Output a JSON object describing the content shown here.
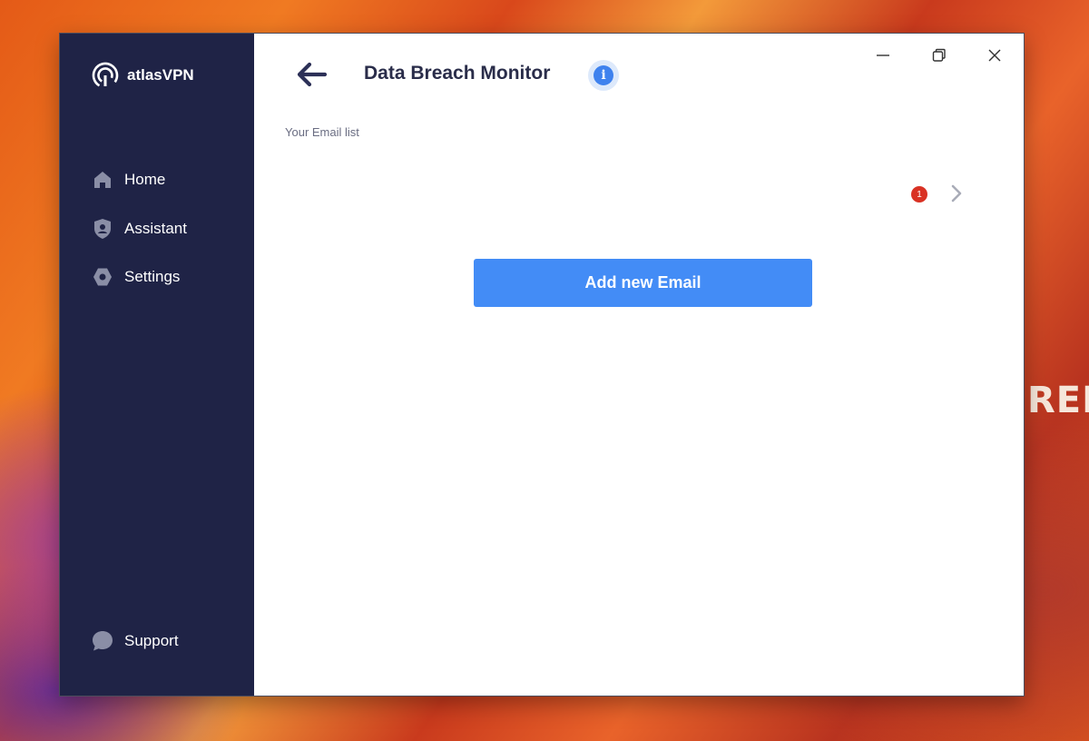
{
  "app": {
    "brand_name": "atlasVPN"
  },
  "sidebar": {
    "items": [
      {
        "label": "Home",
        "icon": "home-icon"
      },
      {
        "label": "Assistant",
        "icon": "assistant-shield-icon"
      },
      {
        "label": "Settings",
        "icon": "settings-hex-icon"
      }
    ],
    "support": {
      "label": "Support",
      "icon": "chat-bubble-icon"
    }
  },
  "window_controls": {
    "minimize": "minimize-icon",
    "restore": "restore-icon",
    "close": "close-icon"
  },
  "header": {
    "title": "Data Breach Monitor",
    "back_icon": "arrow-left-icon",
    "info_glyph": "i"
  },
  "main": {
    "section_label": "Your Email list",
    "email_row": {
      "badge_count": "1"
    },
    "add_button_label": "Add new Email"
  },
  "wallpaper": {
    "text": "REDI"
  },
  "colors": {
    "sidebar_bg": "#1f2346",
    "accent": "#438cf6",
    "badge": "#d93224",
    "title_text": "#2a2d4a"
  }
}
